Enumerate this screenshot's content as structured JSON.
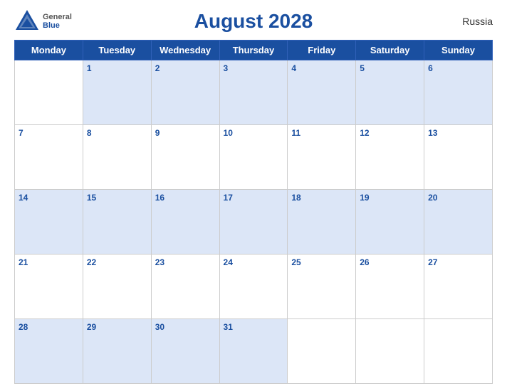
{
  "header": {
    "title": "August 2028",
    "country": "Russia",
    "logo_general": "General",
    "logo_blue": "Blue"
  },
  "calendar": {
    "days_of_week": [
      "Monday",
      "Tuesday",
      "Wednesday",
      "Thursday",
      "Friday",
      "Saturday",
      "Sunday"
    ],
    "weeks": [
      [
        "",
        "1",
        "2",
        "3",
        "4",
        "5",
        "6"
      ],
      [
        "7",
        "8",
        "9",
        "10",
        "11",
        "12",
        "13"
      ],
      [
        "14",
        "15",
        "16",
        "17",
        "18",
        "19",
        "20"
      ],
      [
        "21",
        "22",
        "23",
        "24",
        "25",
        "26",
        "27"
      ],
      [
        "28",
        "29",
        "30",
        "31",
        "",
        "",
        ""
      ]
    ]
  }
}
